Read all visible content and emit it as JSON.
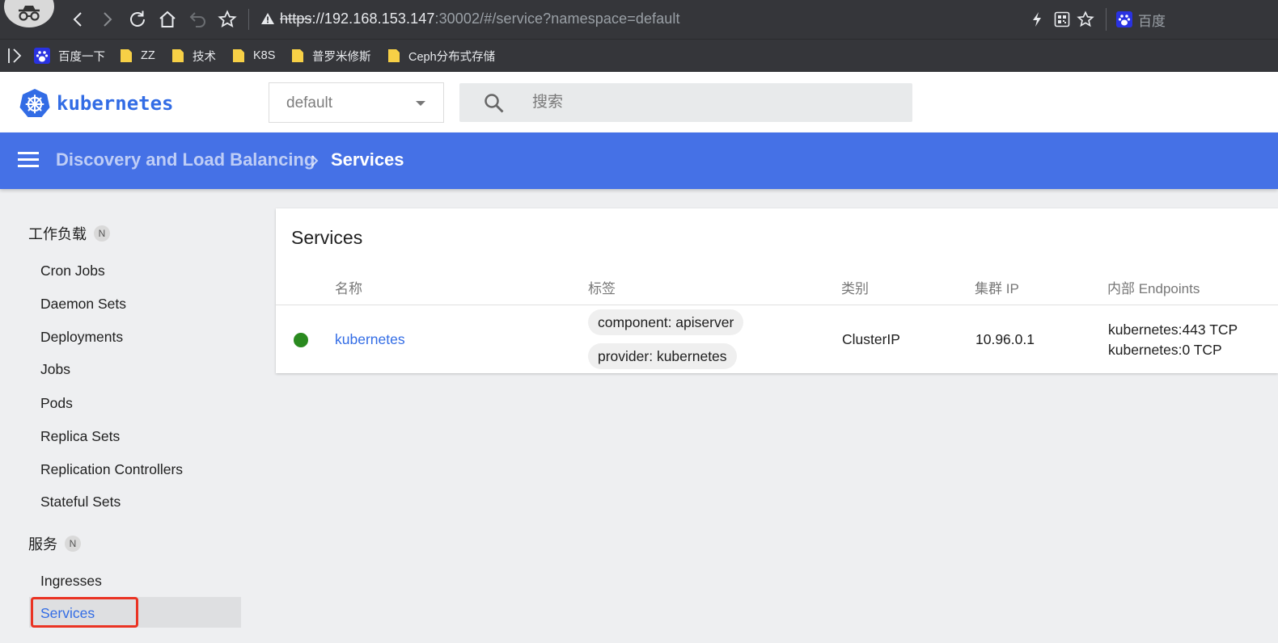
{
  "browser": {
    "url_scheme": "https",
    "url_host": "://192.168.153.147",
    "url_rest": ":30002/#/service?namespace=default",
    "search_engine_label": "百度",
    "bookmarks": [
      "百度一下",
      "ZZ",
      "技术",
      "K8S",
      "普罗米修斯",
      "Ceph分布式存储"
    ]
  },
  "header": {
    "logo_text": "kubernetes",
    "namespace": "default",
    "search_placeholder": "搜索"
  },
  "breadcrumb": {
    "parent": "Discovery and Load Balancing",
    "current": "Services"
  },
  "sidebar": {
    "workloads_title": "工作负载",
    "workloads_badge": "N",
    "workloads_items": [
      "Cron Jobs",
      "Daemon Sets",
      "Deployments",
      "Jobs",
      "Pods",
      "Replica Sets",
      "Replication Controllers",
      "Stateful Sets"
    ],
    "services_title": "服务",
    "services_badge": "N",
    "services_items": [
      "Ingresses",
      "Services"
    ]
  },
  "main": {
    "card_title": "Services",
    "columns": [
      "名称",
      "标签",
      "类别",
      "集群 IP",
      "内部 Endpoints"
    ],
    "rows": [
      {
        "status": "running",
        "name": "kubernetes",
        "labels": [
          "component: apiserver",
          "provider: kubernetes"
        ],
        "type": "ClusterIP",
        "cluster_ip": "10.96.0.1",
        "endpoints": [
          "kubernetes:443 TCP",
          "kubernetes:0 TCP"
        ]
      }
    ]
  },
  "colors": {
    "brand_blue": "#326ce5",
    "toolbar_blue": "#4571e6",
    "status_green": "#2a8a1f",
    "highlight_red": "#ea3323"
  }
}
